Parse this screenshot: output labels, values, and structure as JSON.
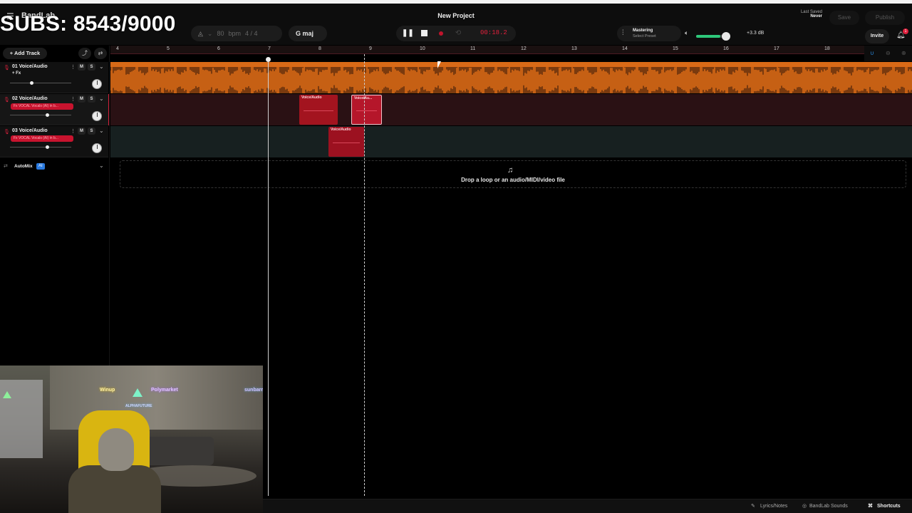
{
  "overlay": {
    "subs_counter": "SUBS: 8543/9000"
  },
  "app": {
    "brand": "BandLab",
    "project_title": "New Project"
  },
  "header": {
    "tempo": "80",
    "tempo_unit": "bpm",
    "time_signature": "4 / 4",
    "key": "G maj",
    "time_display": "00:18.2",
    "mastering_label": "Mastering",
    "mastering_preset": "Select Preset",
    "volume_db": "+3.3 dB",
    "volume_level": 0.82,
    "last_saved_label": "Last Saved",
    "last_saved_value": "Never",
    "save_label": "Save",
    "publish_label": "Publish",
    "invite_label": "Invite",
    "notification_count": "1"
  },
  "sidebar": {
    "add_track_label": "Add Track",
    "automix_label": "AutoMix",
    "automix_badge": "AI"
  },
  "tracks": [
    {
      "name": "01 Voice/Audio",
      "fx_label": "+ Fx",
      "volume_level": 0.35,
      "color": "#d96a17"
    },
    {
      "name": "02 Voice/Audio",
      "fx_label": "Fx VOCAL Vocals (AI) in b...",
      "volume_level": 0.6,
      "color": "#c8132e"
    },
    {
      "name": "03 Voice/Audio",
      "fx_label": "Fx VOCAL Vocals (AI) in b...",
      "volume_level": 0.6,
      "color": "#c8132e"
    }
  ],
  "clips": {
    "track2_clip1": "Voice/Audio",
    "track2_clip2": "Voice/Au...",
    "track3_clip1": "Voice/Audio"
  },
  "ruler": {
    "bars": [
      "4",
      "5",
      "6",
      "7",
      "8",
      "9",
      "10",
      "11",
      "12",
      "13",
      "14",
      "15",
      "16",
      "17",
      "18"
    ]
  },
  "dropzone": {
    "text": "Drop a loop or an audio/MIDI/video file"
  },
  "webcam": {
    "sign1": "Winup",
    "sign2": "Polymarket",
    "sign3": "sunbarry",
    "sign4": "ALPHAFUTURE"
  },
  "footer": {
    "lyrics_label": "Lyrics/Notes",
    "sounds_label": "BandLab Sounds",
    "shortcuts_label": "Shortcuts"
  },
  "colors": {
    "accent_red": "#d0203a",
    "track1_orange": "#d96a17",
    "volume_green": "#2ec77a"
  },
  "icons": [
    "hamburger-icon",
    "metronome-icon",
    "key-icon",
    "pause-icon",
    "stop-icon",
    "record-icon",
    "loop-icon",
    "mastering-icon",
    "speaker-icon",
    "bell-icon",
    "microphone-icon",
    "more-icon",
    "chevron-down-icon",
    "automation-icon",
    "music-note-icon",
    "magnet-icon",
    "zoom-out-icon",
    "zoom-in-icon",
    "pencil-icon",
    "shortcuts-icon"
  ]
}
